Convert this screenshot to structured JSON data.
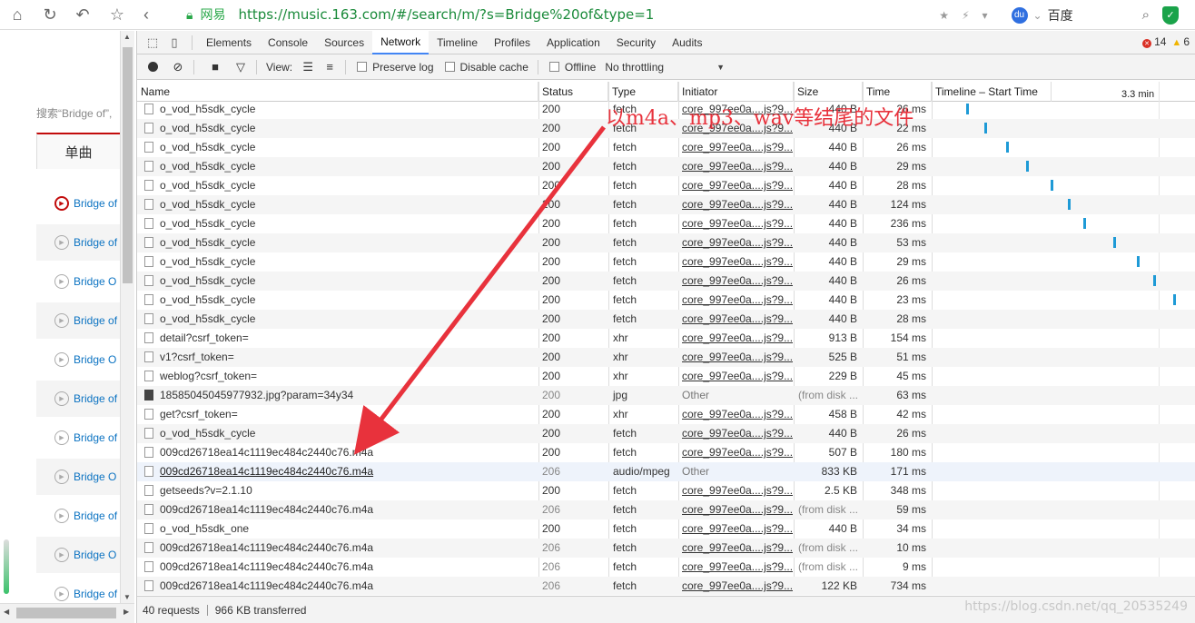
{
  "browser": {
    "site_name": "网易",
    "url": "https://music.163.com/#/search/m/?s=Bridge%20of&type=1",
    "search_engine": "百度"
  },
  "page": {
    "search_hint": "搜索“Bridge of”,",
    "tab_label": "单曲",
    "songs": [
      "Bridge of",
      "Bridge of",
      "Bridge O",
      "Bridge of",
      "Bridge O",
      "Bridge of",
      "Bridge of",
      "Bridge O",
      "Bridge of",
      "Bridge O",
      "Bridge of"
    ]
  },
  "devtools": {
    "tabs": [
      "Elements",
      "Console",
      "Sources",
      "Network",
      "Timeline",
      "Profiles",
      "Application",
      "Security",
      "Audits"
    ],
    "active_tab": "Network",
    "error_count": "14",
    "warning_count": "6",
    "toolbar": {
      "view_label": "View:",
      "preserve_log": "Preserve log",
      "disable_cache": "Disable cache",
      "offline": "Offline",
      "throttling": "No throttling"
    },
    "columns": {
      "name": "Name",
      "status": "Status",
      "type": "Type",
      "initiator": "Initiator",
      "size": "Size",
      "time": "Time",
      "timeline": "Timeline – Start Time",
      "timeline_mark": "3.3 min"
    },
    "rows": [
      {
        "name": "o_vod_h5sdk_cycle",
        "status": "200",
        "type": "fetch",
        "initiator": "core_997ee0a....js?9...",
        "size": "440 B",
        "time": "26 ms"
      },
      {
        "name": "o_vod_h5sdk_cycle",
        "status": "200",
        "type": "fetch",
        "initiator": "core_997ee0a....js?9...",
        "size": "440 B",
        "time": "22 ms"
      },
      {
        "name": "o_vod_h5sdk_cycle",
        "status": "200",
        "type": "fetch",
        "initiator": "core_997ee0a....js?9...",
        "size": "440 B",
        "time": "26 ms"
      },
      {
        "name": "o_vod_h5sdk_cycle",
        "status": "200",
        "type": "fetch",
        "initiator": "core_997ee0a....js?9...",
        "size": "440 B",
        "time": "29 ms"
      },
      {
        "name": "o_vod_h5sdk_cycle",
        "status": "200",
        "type": "fetch",
        "initiator": "core_997ee0a....js?9...",
        "size": "440 B",
        "time": "28 ms"
      },
      {
        "name": "o_vod_h5sdk_cycle",
        "status": "200",
        "type": "fetch",
        "initiator": "core_997ee0a....js?9...",
        "size": "440 B",
        "time": "124 ms"
      },
      {
        "name": "o_vod_h5sdk_cycle",
        "status": "200",
        "type": "fetch",
        "initiator": "core_997ee0a....js?9...",
        "size": "440 B",
        "time": "236 ms"
      },
      {
        "name": "o_vod_h5sdk_cycle",
        "status": "200",
        "type": "fetch",
        "initiator": "core_997ee0a....js?9...",
        "size": "440 B",
        "time": "53 ms"
      },
      {
        "name": "o_vod_h5sdk_cycle",
        "status": "200",
        "type": "fetch",
        "initiator": "core_997ee0a....js?9...",
        "size": "440 B",
        "time": "29 ms"
      },
      {
        "name": "o_vod_h5sdk_cycle",
        "status": "200",
        "type": "fetch",
        "initiator": "core_997ee0a....js?9...",
        "size": "440 B",
        "time": "26 ms"
      },
      {
        "name": "o_vod_h5sdk_cycle",
        "status": "200",
        "type": "fetch",
        "initiator": "core_997ee0a....js?9...",
        "size": "440 B",
        "time": "23 ms"
      },
      {
        "name": "o_vod_h5sdk_cycle",
        "status": "200",
        "type": "fetch",
        "initiator": "core_997ee0a....js?9...",
        "size": "440 B",
        "time": "28 ms"
      },
      {
        "name": "detail?csrf_token=",
        "status": "200",
        "type": "xhr",
        "initiator": "core_997ee0a....js?9...",
        "size": "913 B",
        "time": "154 ms"
      },
      {
        "name": "v1?csrf_token=",
        "status": "200",
        "type": "xhr",
        "initiator": "core_997ee0a....js?9...",
        "size": "525 B",
        "time": "51 ms"
      },
      {
        "name": "weblog?csrf_token=",
        "status": "200",
        "type": "xhr",
        "initiator": "core_997ee0a....js?9...",
        "size": "229 B",
        "time": "45 ms"
      },
      {
        "name": "18585045045977932.jpg?param=34y34",
        "status": "200",
        "type": "jpg",
        "initiator": "Other",
        "size": "(from disk ...",
        "time": "63 ms",
        "cached": true,
        "image": true
      },
      {
        "name": "get?csrf_token=",
        "status": "200",
        "type": "xhr",
        "initiator": "core_997ee0a....js?9...",
        "size": "458 B",
        "time": "42 ms"
      },
      {
        "name": "o_vod_h5sdk_cycle",
        "status": "200",
        "type": "fetch",
        "initiator": "core_997ee0a....js?9...",
        "size": "440 B",
        "time": "26 ms"
      },
      {
        "name": "009cd26718ea14c1119ec484c2440c76.m4a",
        "status": "200",
        "type": "fetch",
        "initiator": "core_997ee0a....js?9...",
        "size": "507 B",
        "time": "180 ms"
      },
      {
        "name": "009cd26718ea14c1119ec484c2440c76.m4a",
        "status": "206",
        "type": "audio/mpeg",
        "initiator": "Other",
        "size": "833 KB",
        "time": "171 ms",
        "selected": true
      },
      {
        "name": "getseeds?v=2.1.10",
        "status": "200",
        "type": "fetch",
        "initiator": "core_997ee0a....js?9...",
        "size": "2.5 KB",
        "time": "348 ms"
      },
      {
        "name": "009cd26718ea14c1119ec484c2440c76.m4a",
        "status": "206",
        "type": "fetch",
        "initiator": "core_997ee0a....js?9...",
        "size": "(from disk ...",
        "time": "59 ms",
        "cached": true
      },
      {
        "name": "o_vod_h5sdk_one",
        "status": "200",
        "type": "fetch",
        "initiator": "core_997ee0a....js?9...",
        "size": "440 B",
        "time": "34 ms"
      },
      {
        "name": "009cd26718ea14c1119ec484c2440c76.m4a",
        "status": "206",
        "type": "fetch",
        "initiator": "core_997ee0a....js?9...",
        "size": "(from disk ...",
        "time": "10 ms",
        "cached": true
      },
      {
        "name": "009cd26718ea14c1119ec484c2440c76.m4a",
        "status": "206",
        "type": "fetch",
        "initiator": "core_997ee0a....js?9...",
        "size": "(from disk ...",
        "time": "9 ms",
        "cached": true
      },
      {
        "name": "009cd26718ea14c1119ec484c2440c76.m4a",
        "status": "206",
        "type": "fetch",
        "initiator": "core_997ee0a....js?9...",
        "size": "122 KB",
        "time": "734 ms"
      }
    ],
    "summary": {
      "requests": "40 requests",
      "transferred": "966 KB transferred"
    }
  },
  "annotation": {
    "text": "以m4a、mp3、wav等结尾的文件",
    "color": "#e8323c"
  },
  "watermark": "https://blog.csdn.net/qq_20535249",
  "colors": {
    "accent": "#4285f4",
    "netease_red": "#c20c0c",
    "timeline_bar": "#1e9ad6",
    "url_green": "#1a8a3a"
  }
}
